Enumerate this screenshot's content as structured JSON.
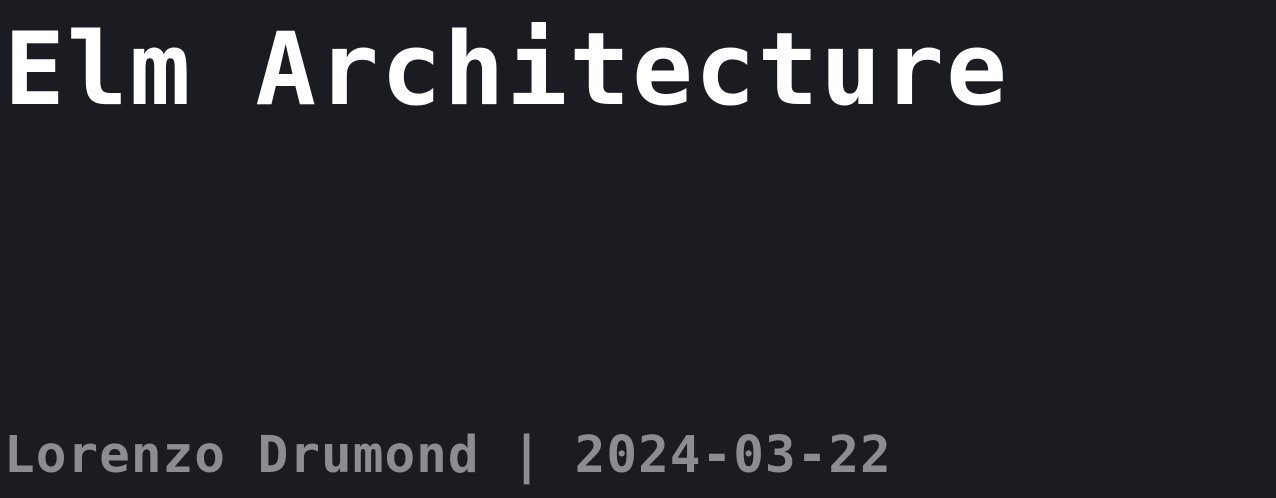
{
  "slide": {
    "title": "Elm Architecture",
    "meta": "Lorenzo Drumond | 2024-03-22"
  },
  "colors": {
    "background": "#1b1c21",
    "title": "#ffffff",
    "meta": "#8c8d93"
  }
}
